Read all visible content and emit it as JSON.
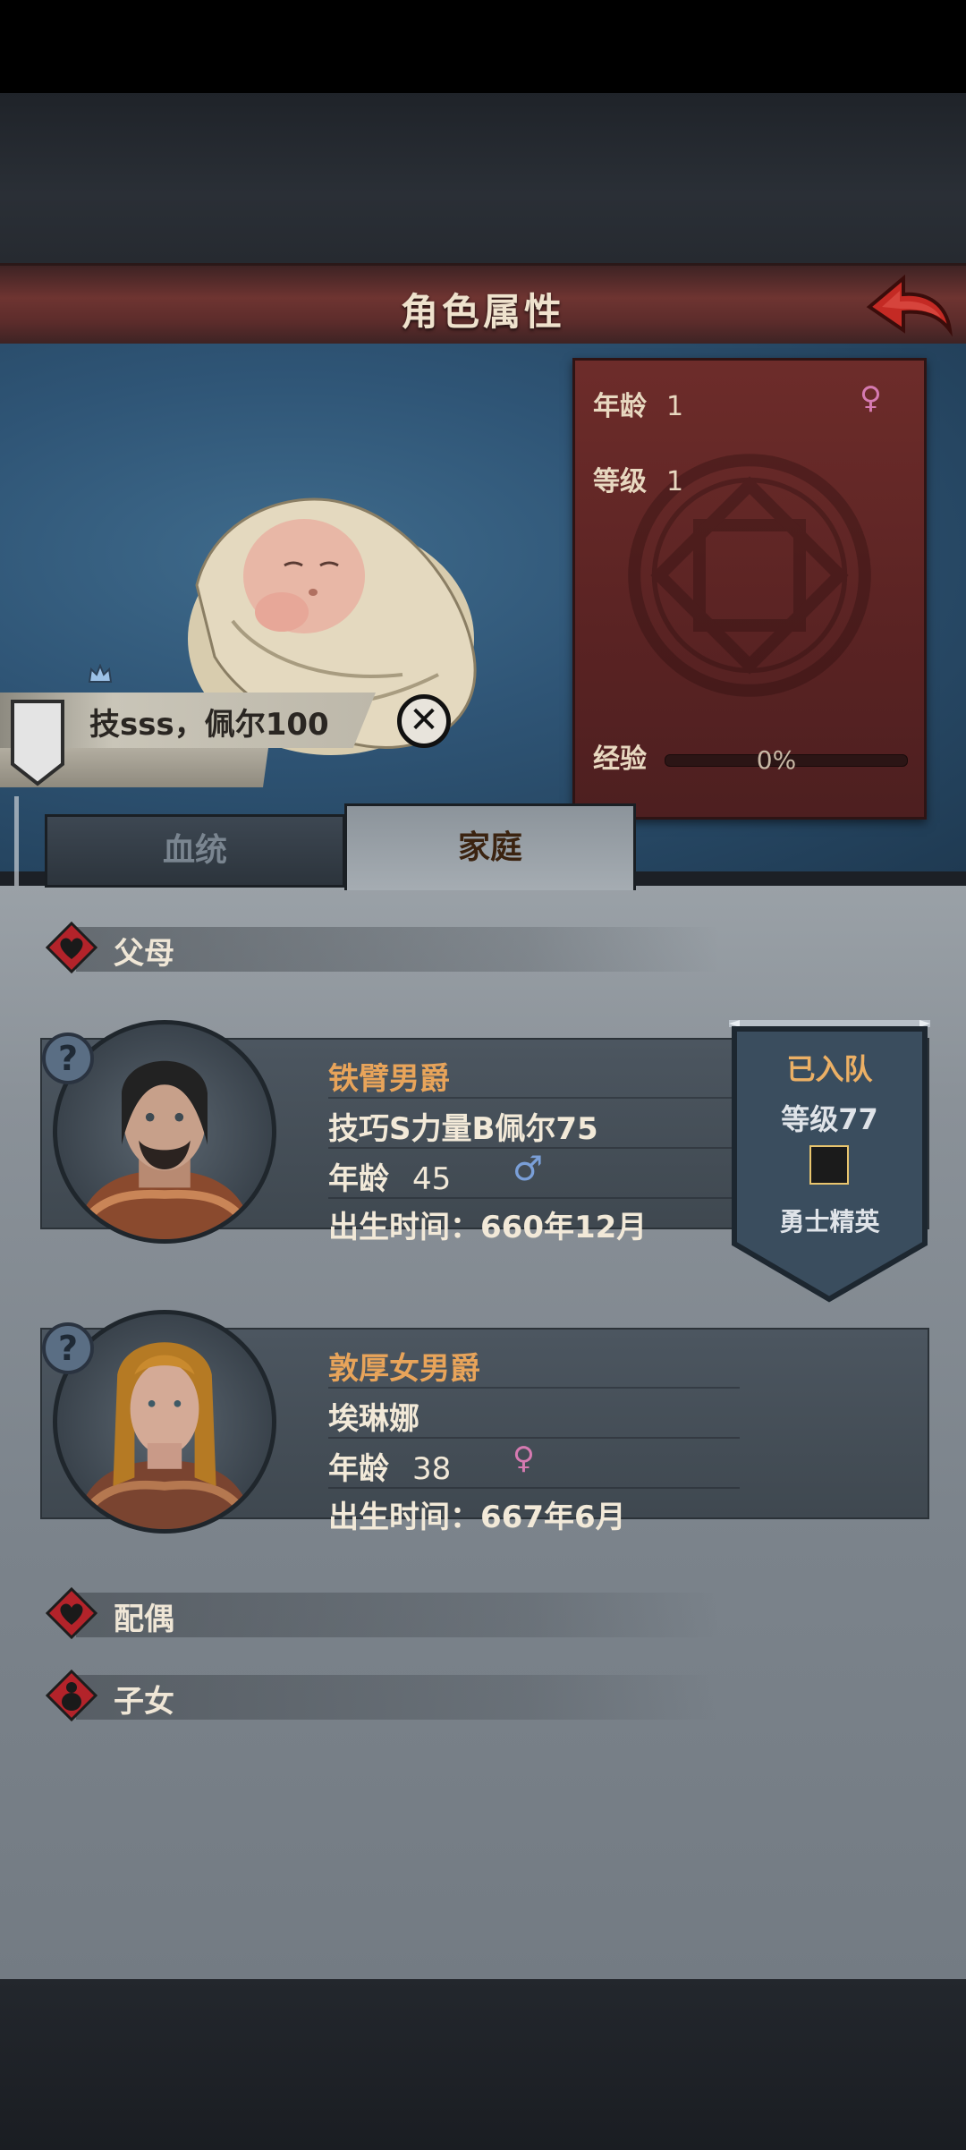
{
  "header": {
    "title": "角色属性"
  },
  "character": {
    "age_label": "年龄",
    "age_value": "1",
    "level_label": "等级",
    "level_value": "1",
    "exp_label": "经验",
    "exp_value": "0%",
    "exp_fraction": 0,
    "gender_icon": "female-icon",
    "trait": "技sss，佩尔100"
  },
  "tabs": [
    {
      "label": "血统",
      "active": false
    },
    {
      "label": "家庭",
      "active": true
    }
  ],
  "sections": {
    "parents": "父母",
    "spouse": "配偶",
    "children": "子女"
  },
  "parents": [
    {
      "title": "铁臂男爵",
      "name": "技巧S力量B佩尔75",
      "age_label": "年龄",
      "age": "45",
      "gender_icon": "male-icon",
      "birth": "出生时间：660年12月"
    },
    {
      "title": "敦厚女男爵",
      "name": "埃琳娜",
      "age_label": "年龄",
      "age": "38",
      "gender_icon": "female-icon",
      "birth": "出生时间：667年6月"
    }
  ],
  "team_badge": {
    "status": "已入队",
    "level": "等级77",
    "rank": "勇士精英"
  },
  "colors": {
    "accent_orange": "#e8a45a",
    "header_red": "#6e3431",
    "female": "#d67ab1",
    "male": "#7a9fd8"
  }
}
